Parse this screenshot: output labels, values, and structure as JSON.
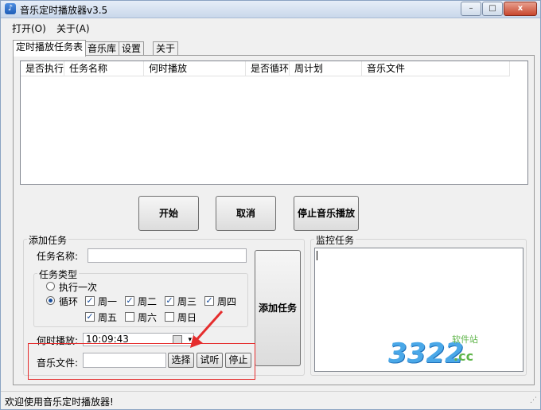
{
  "window": {
    "title": "音乐定时播放器v3.5"
  },
  "window_controls": {
    "minimize": "–",
    "maximize": "□",
    "close": "x"
  },
  "menu": {
    "items": [
      "打开(O)",
      "关于(A)"
    ]
  },
  "tabs": [
    "定时播放任务表",
    "音乐库",
    "设置",
    "关于"
  ],
  "task_list": {
    "columns": [
      "是否执行",
      "任务名称",
      "何时播放",
      "是否循环",
      "周计划",
      "音乐文件"
    ]
  },
  "buttons": {
    "start": "开始",
    "cancel": "取消",
    "stop_music": "停止音乐播放",
    "add_task": "添加任务"
  },
  "add_task": {
    "group_title": "添加任务",
    "task_name_label": "任务名称:",
    "task_name_value": "",
    "task_type_group": "任务类型",
    "task_type_options": [
      "执行一次",
      "循环"
    ],
    "task_type_selected": "循环",
    "weekdays": [
      {
        "label": "周一",
        "checked": true
      },
      {
        "label": "周二",
        "checked": true
      },
      {
        "label": "周三",
        "checked": true
      },
      {
        "label": "周四",
        "checked": true
      },
      {
        "label": "周五",
        "checked": true
      },
      {
        "label": "周六",
        "checked": false
      },
      {
        "label": "周日",
        "checked": false
      }
    ],
    "time_label": "何时播放:",
    "time_value": "10:09:43",
    "music_label": "音乐文件:",
    "music_value": "",
    "choose_label": "选择",
    "preview_label": "试听",
    "stop_label": "停止"
  },
  "monitor": {
    "group_title": "监控任务"
  },
  "watermark": {
    "text": "3322",
    "suffix": ".cc",
    "tag": "软件站"
  },
  "colors": {
    "annotation_red": "#e52d2d"
  },
  "status_bar": {
    "text": "欢迎使用音乐定时播放器!"
  }
}
